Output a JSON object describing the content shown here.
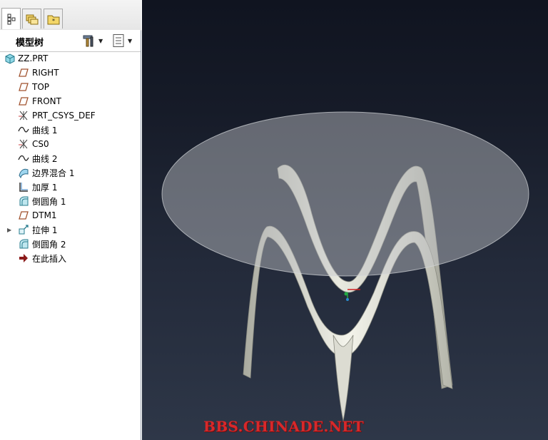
{
  "tabs": [
    {
      "name": "model-tree-tab",
      "icon": "tree-icon",
      "active": true
    },
    {
      "name": "layers-tab",
      "icon": "folder-layers-icon",
      "active": false
    },
    {
      "name": "favorites-tab",
      "icon": "star-folder-icon",
      "active": false
    }
  ],
  "panel": {
    "title": "模型树",
    "settings_icon": "tools-icon",
    "show_icon": "list-icon"
  },
  "tree": {
    "root": "ZZ.PRT",
    "items": [
      {
        "label": "RIGHT",
        "icon": "datum-plane-icon"
      },
      {
        "label": "TOP",
        "icon": "datum-plane-icon"
      },
      {
        "label": "FRONT",
        "icon": "datum-plane-icon"
      },
      {
        "label": "PRT_CSYS_DEF",
        "icon": "coordinate-system-icon"
      },
      {
        "label": "曲线 1",
        "icon": "curve-icon"
      },
      {
        "label": "CS0",
        "icon": "coordinate-system-icon"
      },
      {
        "label": "曲线 2",
        "icon": "curve-icon"
      },
      {
        "label": "边界混合 1",
        "icon": "boundary-blend-icon"
      },
      {
        "label": "加厚 1",
        "icon": "thicken-icon"
      },
      {
        "label": "倒圆角 1",
        "icon": "round-icon"
      },
      {
        "label": "DTM1",
        "icon": "datum-plane-icon"
      },
      {
        "label": "拉伸 1",
        "icon": "extrude-icon",
        "expandable": true
      },
      {
        "label": "倒圆角 2",
        "icon": "round-icon"
      },
      {
        "label": "在此插入",
        "icon": "insert-here-arrow-icon"
      }
    ]
  },
  "viewport": {
    "watermark": "BBS.CHINADE.NET",
    "accent_color": "#d8282a",
    "background_top": "#101420",
    "background_bottom": "#2e3748"
  }
}
